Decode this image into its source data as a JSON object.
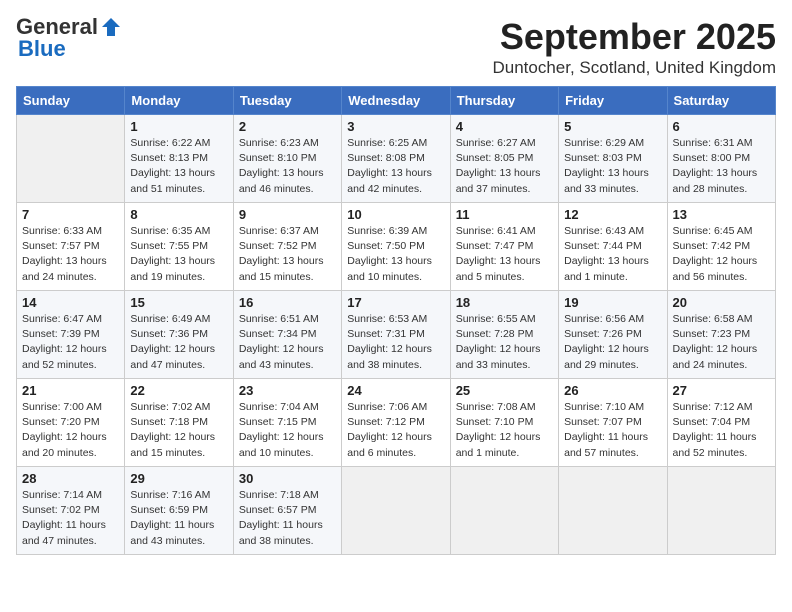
{
  "header": {
    "logo_general": "General",
    "logo_blue": "Blue",
    "month": "September 2025",
    "location": "Duntocher, Scotland, United Kingdom"
  },
  "days_of_week": [
    "Sunday",
    "Monday",
    "Tuesday",
    "Wednesday",
    "Thursday",
    "Friday",
    "Saturday"
  ],
  "weeks": [
    [
      {
        "num": "",
        "sunrise": "",
        "sunset": "",
        "daylight": ""
      },
      {
        "num": "1",
        "sunrise": "Sunrise: 6:22 AM",
        "sunset": "Sunset: 8:13 PM",
        "daylight": "Daylight: 13 hours and 51 minutes."
      },
      {
        "num": "2",
        "sunrise": "Sunrise: 6:23 AM",
        "sunset": "Sunset: 8:10 PM",
        "daylight": "Daylight: 13 hours and 46 minutes."
      },
      {
        "num": "3",
        "sunrise": "Sunrise: 6:25 AM",
        "sunset": "Sunset: 8:08 PM",
        "daylight": "Daylight: 13 hours and 42 minutes."
      },
      {
        "num": "4",
        "sunrise": "Sunrise: 6:27 AM",
        "sunset": "Sunset: 8:05 PM",
        "daylight": "Daylight: 13 hours and 37 minutes."
      },
      {
        "num": "5",
        "sunrise": "Sunrise: 6:29 AM",
        "sunset": "Sunset: 8:03 PM",
        "daylight": "Daylight: 13 hours and 33 minutes."
      },
      {
        "num": "6",
        "sunrise": "Sunrise: 6:31 AM",
        "sunset": "Sunset: 8:00 PM",
        "daylight": "Daylight: 13 hours and 28 minutes."
      }
    ],
    [
      {
        "num": "7",
        "sunrise": "Sunrise: 6:33 AM",
        "sunset": "Sunset: 7:57 PM",
        "daylight": "Daylight: 13 hours and 24 minutes."
      },
      {
        "num": "8",
        "sunrise": "Sunrise: 6:35 AM",
        "sunset": "Sunset: 7:55 PM",
        "daylight": "Daylight: 13 hours and 19 minutes."
      },
      {
        "num": "9",
        "sunrise": "Sunrise: 6:37 AM",
        "sunset": "Sunset: 7:52 PM",
        "daylight": "Daylight: 13 hours and 15 minutes."
      },
      {
        "num": "10",
        "sunrise": "Sunrise: 6:39 AM",
        "sunset": "Sunset: 7:50 PM",
        "daylight": "Daylight: 13 hours and 10 minutes."
      },
      {
        "num": "11",
        "sunrise": "Sunrise: 6:41 AM",
        "sunset": "Sunset: 7:47 PM",
        "daylight": "Daylight: 13 hours and 5 minutes."
      },
      {
        "num": "12",
        "sunrise": "Sunrise: 6:43 AM",
        "sunset": "Sunset: 7:44 PM",
        "daylight": "Daylight: 13 hours and 1 minute."
      },
      {
        "num": "13",
        "sunrise": "Sunrise: 6:45 AM",
        "sunset": "Sunset: 7:42 PM",
        "daylight": "Daylight: 12 hours and 56 minutes."
      }
    ],
    [
      {
        "num": "14",
        "sunrise": "Sunrise: 6:47 AM",
        "sunset": "Sunset: 7:39 PM",
        "daylight": "Daylight: 12 hours and 52 minutes."
      },
      {
        "num": "15",
        "sunrise": "Sunrise: 6:49 AM",
        "sunset": "Sunset: 7:36 PM",
        "daylight": "Daylight: 12 hours and 47 minutes."
      },
      {
        "num": "16",
        "sunrise": "Sunrise: 6:51 AM",
        "sunset": "Sunset: 7:34 PM",
        "daylight": "Daylight: 12 hours and 43 minutes."
      },
      {
        "num": "17",
        "sunrise": "Sunrise: 6:53 AM",
        "sunset": "Sunset: 7:31 PM",
        "daylight": "Daylight: 12 hours and 38 minutes."
      },
      {
        "num": "18",
        "sunrise": "Sunrise: 6:55 AM",
        "sunset": "Sunset: 7:28 PM",
        "daylight": "Daylight: 12 hours and 33 minutes."
      },
      {
        "num": "19",
        "sunrise": "Sunrise: 6:56 AM",
        "sunset": "Sunset: 7:26 PM",
        "daylight": "Daylight: 12 hours and 29 minutes."
      },
      {
        "num": "20",
        "sunrise": "Sunrise: 6:58 AM",
        "sunset": "Sunset: 7:23 PM",
        "daylight": "Daylight: 12 hours and 24 minutes."
      }
    ],
    [
      {
        "num": "21",
        "sunrise": "Sunrise: 7:00 AM",
        "sunset": "Sunset: 7:20 PM",
        "daylight": "Daylight: 12 hours and 20 minutes."
      },
      {
        "num": "22",
        "sunrise": "Sunrise: 7:02 AM",
        "sunset": "Sunset: 7:18 PM",
        "daylight": "Daylight: 12 hours and 15 minutes."
      },
      {
        "num": "23",
        "sunrise": "Sunrise: 7:04 AM",
        "sunset": "Sunset: 7:15 PM",
        "daylight": "Daylight: 12 hours and 10 minutes."
      },
      {
        "num": "24",
        "sunrise": "Sunrise: 7:06 AM",
        "sunset": "Sunset: 7:12 PM",
        "daylight": "Daylight: 12 hours and 6 minutes."
      },
      {
        "num": "25",
        "sunrise": "Sunrise: 7:08 AM",
        "sunset": "Sunset: 7:10 PM",
        "daylight": "Daylight: 12 hours and 1 minute."
      },
      {
        "num": "26",
        "sunrise": "Sunrise: 7:10 AM",
        "sunset": "Sunset: 7:07 PM",
        "daylight": "Daylight: 11 hours and 57 minutes."
      },
      {
        "num": "27",
        "sunrise": "Sunrise: 7:12 AM",
        "sunset": "Sunset: 7:04 PM",
        "daylight": "Daylight: 11 hours and 52 minutes."
      }
    ],
    [
      {
        "num": "28",
        "sunrise": "Sunrise: 7:14 AM",
        "sunset": "Sunset: 7:02 PM",
        "daylight": "Daylight: 11 hours and 47 minutes."
      },
      {
        "num": "29",
        "sunrise": "Sunrise: 7:16 AM",
        "sunset": "Sunset: 6:59 PM",
        "daylight": "Daylight: 11 hours and 43 minutes."
      },
      {
        "num": "30",
        "sunrise": "Sunrise: 7:18 AM",
        "sunset": "Sunset: 6:57 PM",
        "daylight": "Daylight: 11 hours and 38 minutes."
      },
      {
        "num": "",
        "sunrise": "",
        "sunset": "",
        "daylight": ""
      },
      {
        "num": "",
        "sunrise": "",
        "sunset": "",
        "daylight": ""
      },
      {
        "num": "",
        "sunrise": "",
        "sunset": "",
        "daylight": ""
      },
      {
        "num": "",
        "sunrise": "",
        "sunset": "",
        "daylight": ""
      }
    ]
  ]
}
